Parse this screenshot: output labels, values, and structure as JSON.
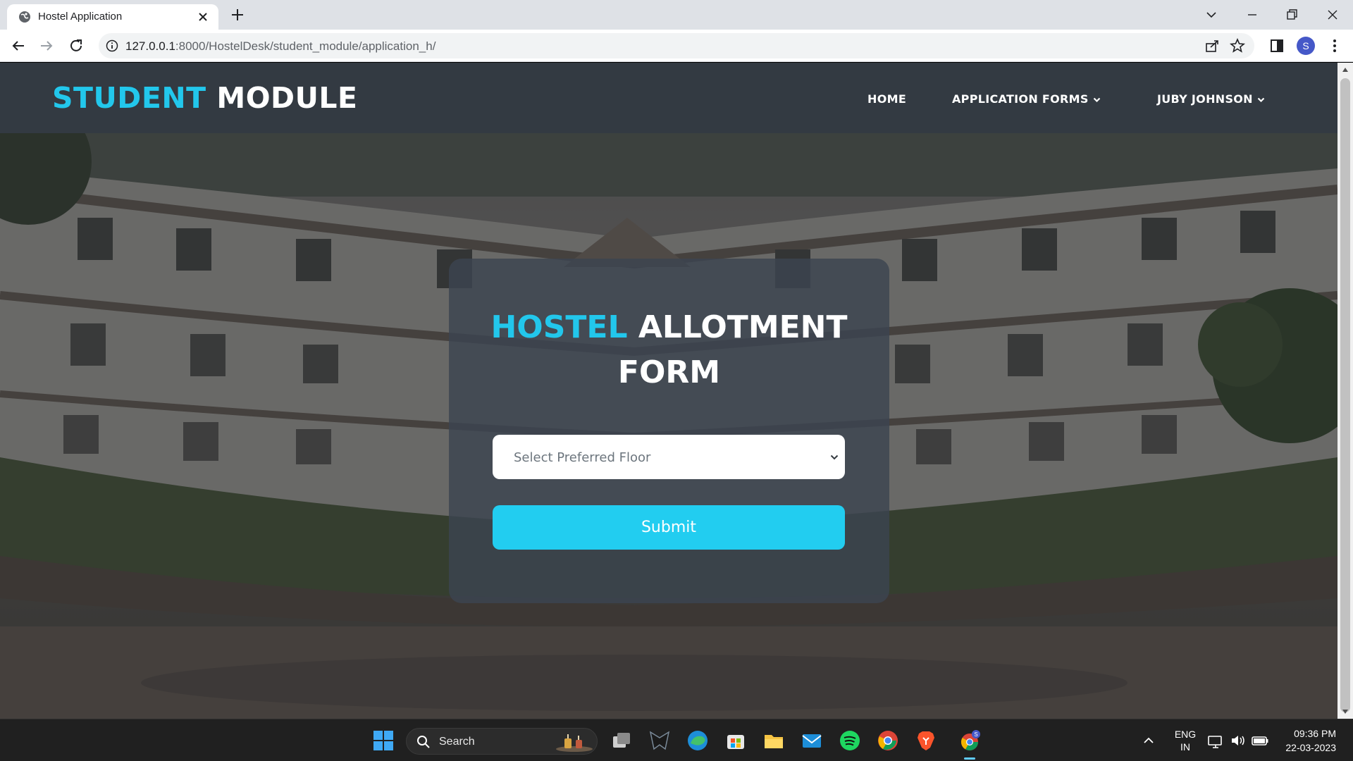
{
  "browser": {
    "tab_title": "Hostel Application",
    "url_host": "127.0.0.1",
    "url_path": ":8000/HostelDesk/student_module/application_h/",
    "profile_initial": "S"
  },
  "site": {
    "brand_accent": "STUDENT",
    "brand_rest": "MODULE",
    "nav": {
      "home": "HOME",
      "application_forms": "APPLICATION FORMS",
      "user": "JUBY JOHNSON"
    }
  },
  "form": {
    "title_accent": "HOSTEL",
    "title_rest": "ALLOTMENT FORM",
    "floor_select_placeholder": "Select Preferred Floor",
    "submit_label": "Submit"
  },
  "taskbar": {
    "search_label": "Search",
    "lang_line1": "ENG",
    "lang_line2": "IN",
    "time": "09:36 PM",
    "date": "22-03-2023",
    "chrome_badge": "S"
  },
  "colors": {
    "accent": "#22c7ec",
    "nav_bg": "#333a42",
    "button_bg": "#22cdf0"
  }
}
